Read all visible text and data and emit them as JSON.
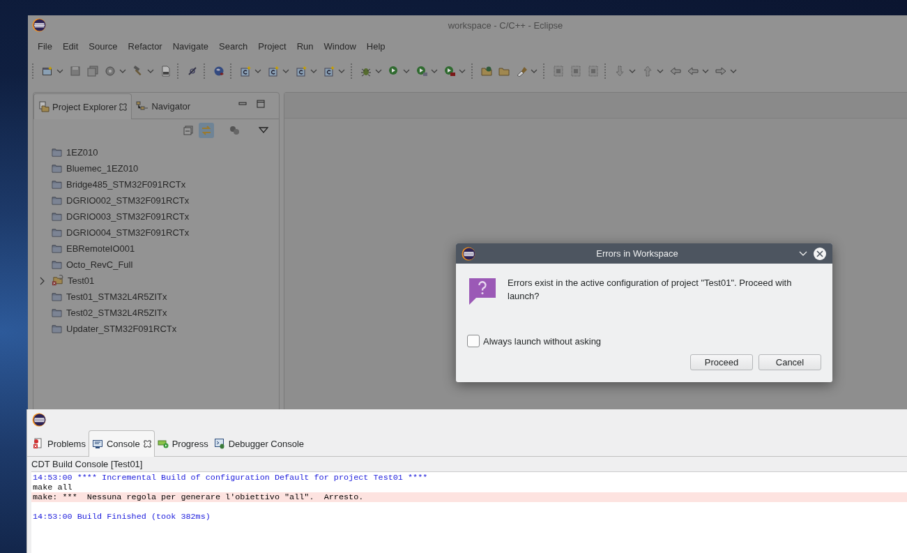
{
  "main_window": {
    "title": "workspace - C/C++ - Eclipse",
    "menu": [
      "File",
      "Edit",
      "Source",
      "Refactor",
      "Navigate",
      "Search",
      "Project",
      "Run",
      "Window",
      "Help"
    ],
    "explorer_tabs": [
      {
        "label": "Project Explorer",
        "selected": true
      },
      {
        "label": "Navigator",
        "selected": false
      }
    ],
    "projects": [
      {
        "name": "1EZ010",
        "kind": "folder"
      },
      {
        "name": "Bluemec_1EZ010",
        "kind": "folder"
      },
      {
        "name": "Bridge485_STM32F091RCTx",
        "kind": "folder"
      },
      {
        "name": "DGRIO002_STM32F091RCTx",
        "kind": "folder"
      },
      {
        "name": "DGRIO003_STM32F091RCTx",
        "kind": "folder"
      },
      {
        "name": "DGRIO004_STM32F091RCTx",
        "kind": "folder"
      },
      {
        "name": "EBRemoteIO001",
        "kind": "folder"
      },
      {
        "name": "Octo_RevC_Full",
        "kind": "folder"
      },
      {
        "name": "Test01",
        "kind": "error_project",
        "expanded": false
      },
      {
        "name": "Test01_STM32L4R5ZITx",
        "kind": "folder"
      },
      {
        "name": "Test02_STM32L4R5ZITx",
        "kind": "folder"
      },
      {
        "name": "Updater_STM32F091RCTx",
        "kind": "folder"
      }
    ]
  },
  "console_window": {
    "tabs": [
      {
        "label": "Problems",
        "kind": "problems",
        "selected": false
      },
      {
        "label": "Console",
        "kind": "console",
        "selected": true
      },
      {
        "label": "Progress",
        "kind": "progress",
        "selected": false
      },
      {
        "label": "Debugger Console",
        "kind": "debugger",
        "selected": false
      }
    ],
    "console_title": "CDT Build Console [Test01]",
    "lines": [
      {
        "kind": "info",
        "text": "14:53:00 **** Incremental Build of configuration Default for project Test01 ****"
      },
      {
        "kind": "output",
        "text": "make all"
      },
      {
        "kind": "error",
        "text": "make: ***  Nessuna regola per generare l'obiettivo \"all\".  Arresto."
      },
      {
        "kind": "blank"
      },
      {
        "kind": "info",
        "text": "14:53:00 Build Finished (took 382ms)"
      }
    ]
  },
  "dialog": {
    "title": "Errors in Workspace",
    "message": "Errors exist in the active configuration of project \"Test01\". Proceed with launch?",
    "checkbox": {
      "label": "Always launch without asking",
      "checked": false
    },
    "buttons": [
      "Proceed",
      "Cancel"
    ]
  }
}
